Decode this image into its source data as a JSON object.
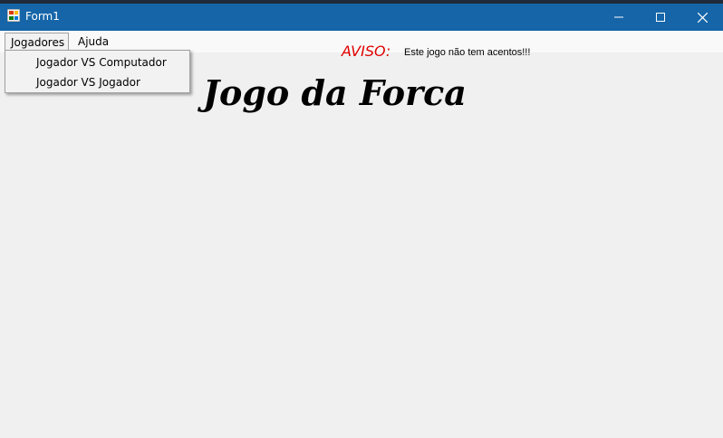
{
  "window": {
    "title": "Form1",
    "icon": "winforms-app-icon",
    "controls": {
      "minimize_icon": "minimize-icon",
      "maximize_icon": "maximize-icon",
      "close_icon": "close-icon"
    },
    "titlebar_color": "#1565a8"
  },
  "menubar": {
    "items": [
      {
        "label": "Jogadores",
        "open": true
      },
      {
        "label": "Ajuda",
        "open": false
      }
    ]
  },
  "dropdown": {
    "items": [
      {
        "label": "Jogador VS Computador"
      },
      {
        "label": "Jogador VS Jogador"
      }
    ]
  },
  "warning": {
    "label": "AVISO:",
    "text": "Este jogo não tem acentos!!!",
    "label_color": "#e00000"
  },
  "main": {
    "title": "Jogo da Forca"
  }
}
